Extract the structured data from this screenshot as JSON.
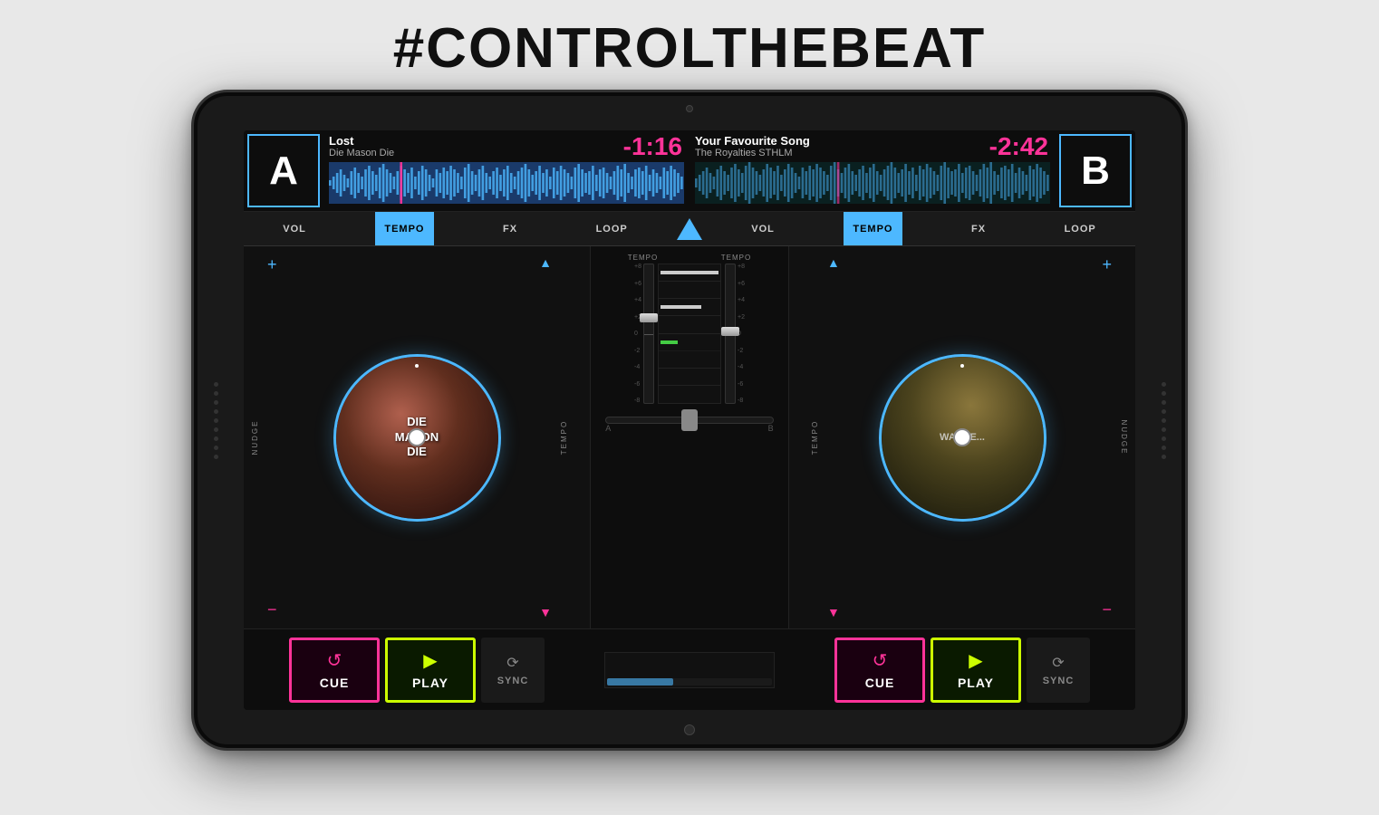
{
  "headline": "#CONTROLTHEBEAT",
  "deck_a": {
    "label": "A",
    "track_title": "Lost",
    "track_artist": "Die Mason Die",
    "timer": "-1:16",
    "turntable_text": "DIE\nMASON\nDIE",
    "plus_label": "+",
    "minus_label": "−",
    "nudge_label": "NUDGE",
    "tempo_label": "TEMPO"
  },
  "deck_b": {
    "label": "B",
    "track_title": "Your Favourite Song",
    "track_artist": "The Royalties STHLM",
    "timer": "-2:42",
    "turntable_text": "WALTI...",
    "plus_label": "+",
    "minus_label": "−",
    "nudge_label": "NUDGE",
    "tempo_label": "TEMPO"
  },
  "tabs_a": {
    "vol": "VOL",
    "tempo": "TEMPO",
    "fx": "FX",
    "loop": "LOOP"
  },
  "tabs_b": {
    "vol": "VOL",
    "tempo": "TEMPO",
    "fx": "FX",
    "loop": "LOOP"
  },
  "transport_a": {
    "cue": "CUE",
    "play": "PLAY",
    "sync": "SYNC"
  },
  "transport_b": {
    "cue": "CUE",
    "play": "PLAY",
    "sync": "SYNC"
  },
  "fader_scale": [
    "+8",
    "+6",
    "+4",
    "+2",
    "0",
    "-2",
    "-4",
    "-6",
    "-8"
  ],
  "colors": {
    "blue": "#4db8ff",
    "pink": "#ff3399",
    "green_btn": "#ccff00",
    "dark_bg": "#111111",
    "mid_bg": "#1a1a1a"
  }
}
